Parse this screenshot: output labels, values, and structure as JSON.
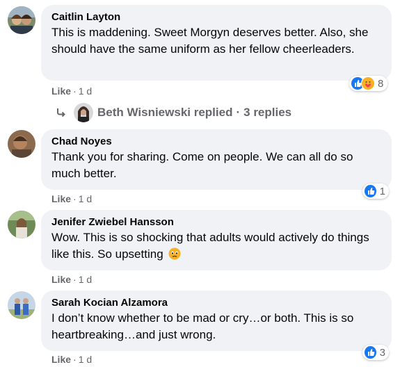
{
  "comments": [
    {
      "author": "Caitlin Layton",
      "text": "This is maddening. Sweet Morgyn deserves better. Also, she should have the same uniform as her fellow cheerleaders.",
      "like_label": "Like",
      "time": "1 d",
      "reactions": {
        "icons": [
          "like-reaction",
          "care-reaction"
        ],
        "count": "8"
      },
      "replies": {
        "author": "Beth Wisniewski replied",
        "sep": "·",
        "count": "3 replies"
      }
    },
    {
      "author": "Chad Noyes",
      "text": "Thank you for sharing. Come on people. We can all do so much better.",
      "like_label": "Like",
      "time": "1 d",
      "reactions": {
        "icons": [
          "like-reaction"
        ],
        "count": "1"
      }
    },
    {
      "author": "Jenifer Zwiebel Hansson",
      "text": "Wow. This is so shocking that adults would actively do things like this. So upsetting",
      "like_label": "Like",
      "time": "1 d"
    },
    {
      "author": "Sarah Kocian Alzamora",
      "text": "I don’t know whether to be mad or cry…or both. This is so heartbreaking…and just wrong.",
      "like_label": "Like",
      "time": "1 d",
      "reactions": {
        "icons": [
          "like-reaction"
        ],
        "count": "3"
      }
    }
  ],
  "colors": {
    "bubble": "#f0f2f5",
    "like_blue": "#1877f2",
    "meta_gray": "#65676b",
    "care_yellow": "#f7b125"
  }
}
